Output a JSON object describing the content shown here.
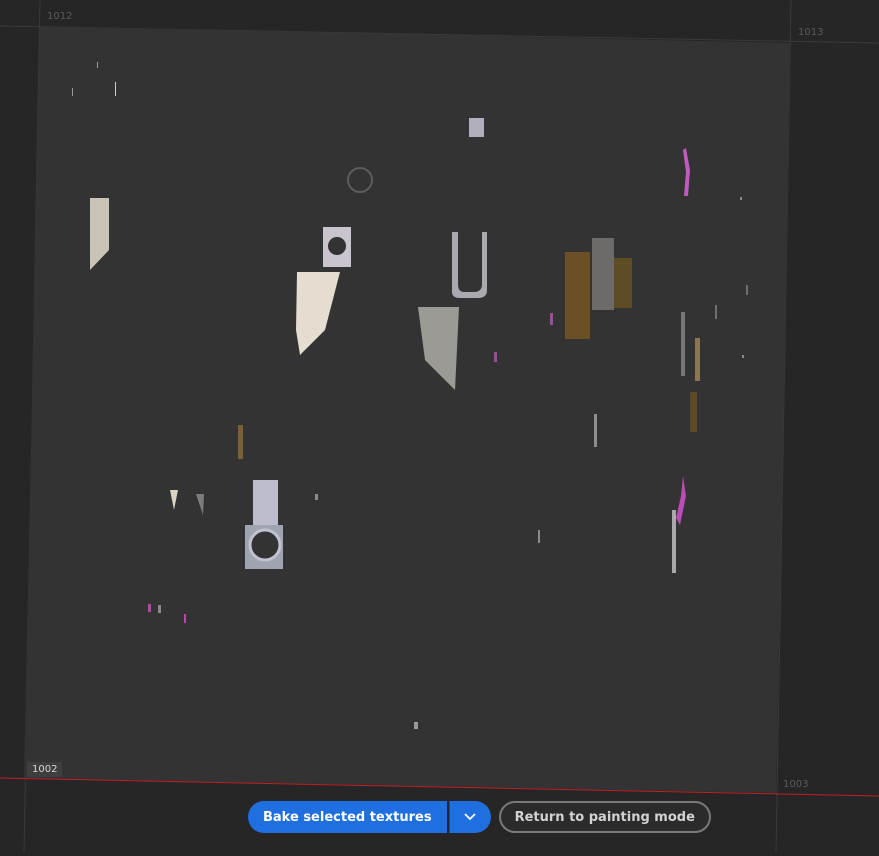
{
  "tiles": [
    {
      "id": "1012"
    },
    {
      "id": "1013"
    },
    {
      "id": "1002",
      "active": true
    },
    {
      "id": "1003"
    }
  ],
  "toolbar": {
    "bake_label": "Bake selected textures",
    "dropdown_icon": "chevron-down-icon",
    "return_label": "Return to painting mode"
  },
  "colors": {
    "background": "#262626",
    "uv_tile": "#333333",
    "boundary_line": "#c02020",
    "accent": "#1f6fe0",
    "seam_highlight": "#d060d0"
  }
}
